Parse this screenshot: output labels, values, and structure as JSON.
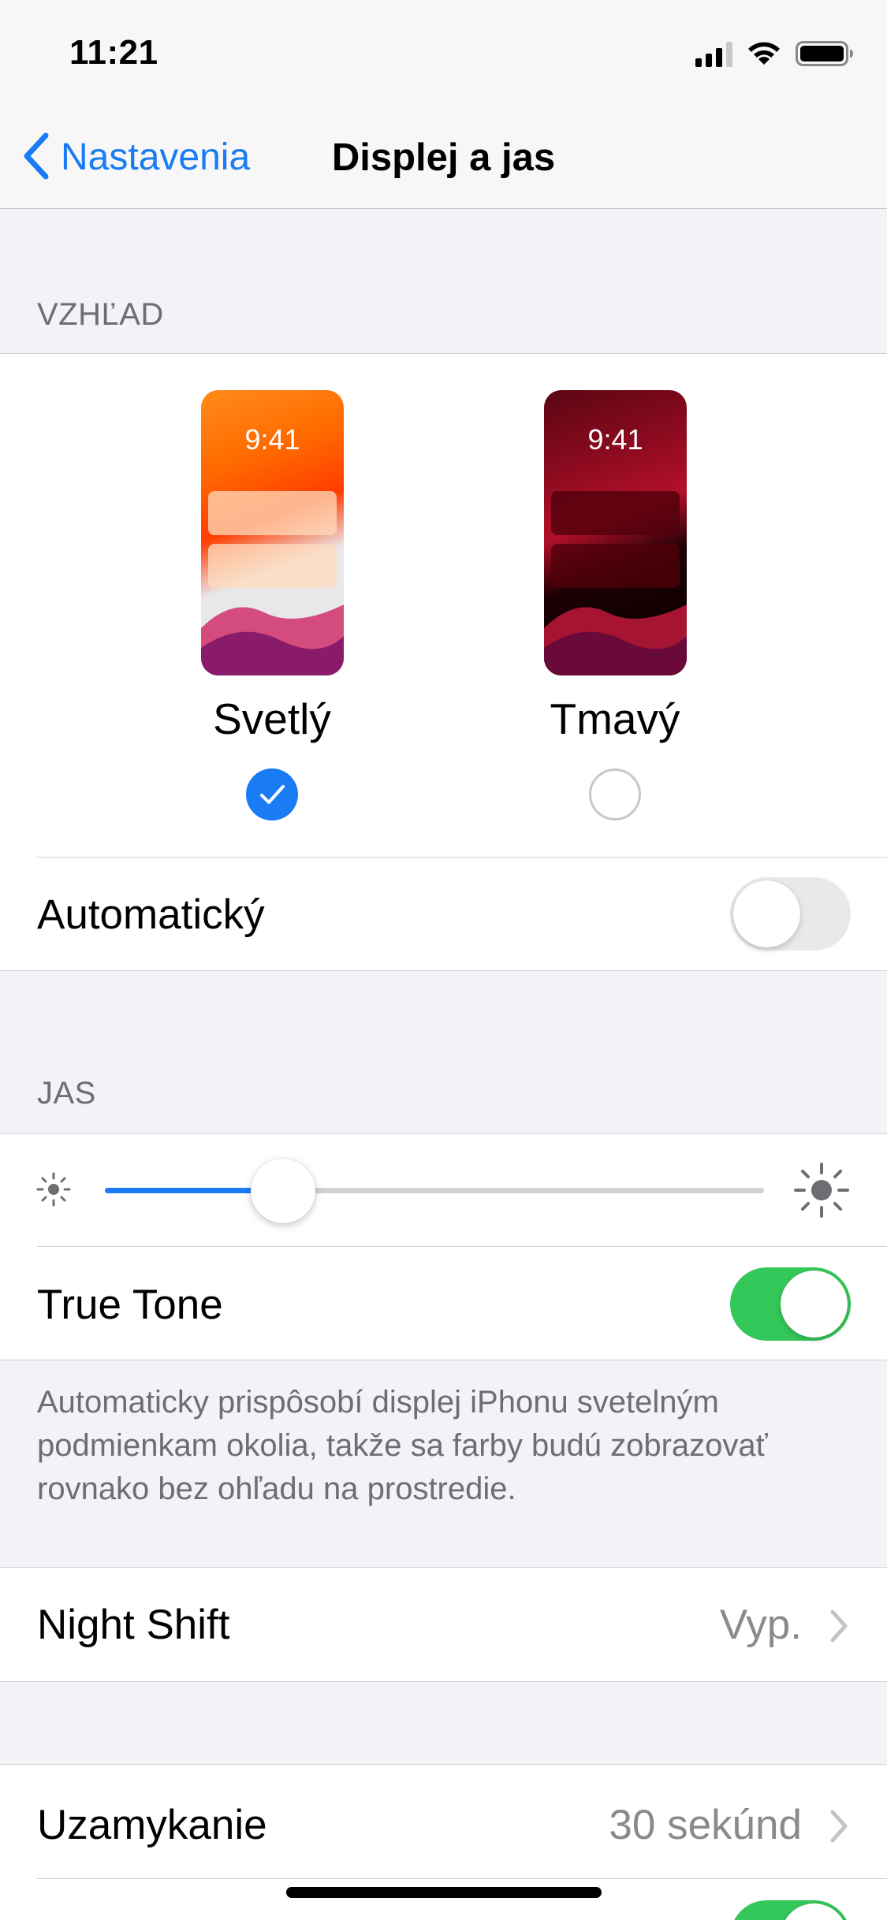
{
  "status_bar": {
    "time": "11:21"
  },
  "nav": {
    "back_label": "Nastavenia",
    "title": "Displej a jas"
  },
  "appearance": {
    "header": "VZHĽAD",
    "light": {
      "preview_time": "9:41",
      "label": "Svetlý",
      "selected": true
    },
    "dark": {
      "preview_time": "9:41",
      "label": "Tmavý",
      "selected": false
    },
    "automatic": {
      "label": "Automatický",
      "on": false
    }
  },
  "brightness": {
    "header": "JAS",
    "level_fraction": 0.27
  },
  "true_tone": {
    "label": "True Tone",
    "on": true,
    "footer": "Automaticky prispôsobí displej iPhonu svetelným podmienkam okolia, takže sa farby budú zobrazovať rovnako bez ohľadu na prostredie."
  },
  "night_shift": {
    "label": "Night Shift",
    "value": "Vyp."
  },
  "lock": {
    "label": "Uzamykanie",
    "value": "30 sekúnd"
  },
  "colors": {
    "accent": "#1a7cf5",
    "toggle_on": "#34c759",
    "secondary_text": "#8a8a8e",
    "background": "#f2f2f7"
  },
  "icons": {
    "back": "chevron-left-icon",
    "sun_small": "sun-small-icon",
    "sun_large": "sun-large-icon",
    "disclosure": "chevron-right-icon",
    "check": "checkmark-icon"
  }
}
